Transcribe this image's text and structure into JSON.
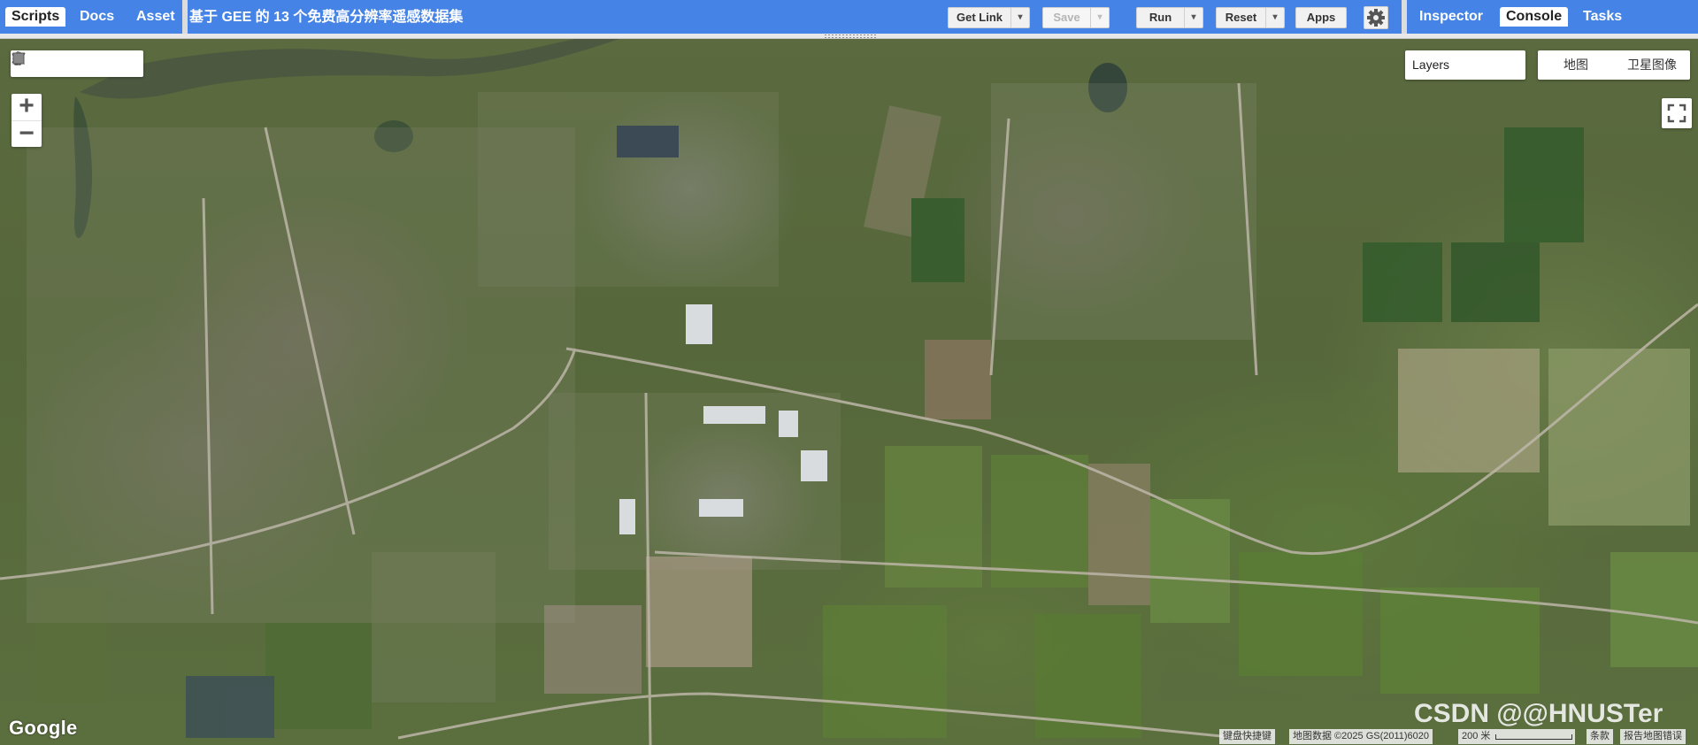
{
  "left_tabs": [
    {
      "label": "Scripts",
      "active": true
    },
    {
      "label": "Docs",
      "active": false
    },
    {
      "label": "Asset",
      "active": false
    }
  ],
  "script_title": "基于 GEE 的 13 个免费高分辨率遥感数据集",
  "toolbar": {
    "get_link": "Get Link",
    "save": "Save",
    "run": "Run",
    "reset": "Reset",
    "apps": "Apps",
    "dropdown_glyph": "▾"
  },
  "right_tabs": [
    {
      "label": "Inspector",
      "active": false
    },
    {
      "label": "Console",
      "active": true
    },
    {
      "label": "Tasks",
      "active": false
    }
  ],
  "map": {
    "zoom_in": "+",
    "zoom_out": "−",
    "layers_label": "Layers",
    "map_types": [
      "地图",
      "卫星图像"
    ],
    "google_logo": "Google",
    "keyboard_shortcuts": "键盘快捷键",
    "map_data": "地图数据 ©2025 GS(2011)6020",
    "scale": "200 米",
    "terms": "条款",
    "report_error": "报告地图错误"
  },
  "watermark": "CSDN @@HNUSTer",
  "icons": [
    "hand-icon",
    "marker-icon",
    "polyline-icon",
    "polygon-icon",
    "rectangle-icon",
    "gear-icon",
    "fullscreen-icon"
  ],
  "colors": {
    "topbar": "#4584e6",
    "active_tab_bg": "#ffffff"
  }
}
